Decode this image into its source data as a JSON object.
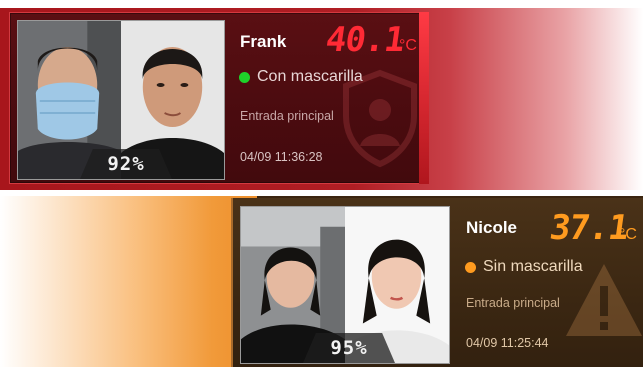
{
  "records": [
    {
      "name": "Frank",
      "temperature": "40.1",
      "unit": "°C",
      "mask_status": "Con mascarilla",
      "status_color": "#1fd12a",
      "location": "Entrada principal",
      "datetime": "04/09  11:36:28",
      "similarity": "92%",
      "accent_color": "#ff2a35",
      "background_icon": "shield-person-icon"
    },
    {
      "name": "Nicole",
      "temperature": "37.1",
      "unit": "°C",
      "mask_status": "Sin mascarilla",
      "status_color": "#ff9b1f",
      "location": "Entrada principal",
      "datetime": "04/09  11:25:44",
      "similarity": "95%",
      "accent_color": "#ff9b1f",
      "background_icon": "warning-triangle-icon"
    }
  ]
}
